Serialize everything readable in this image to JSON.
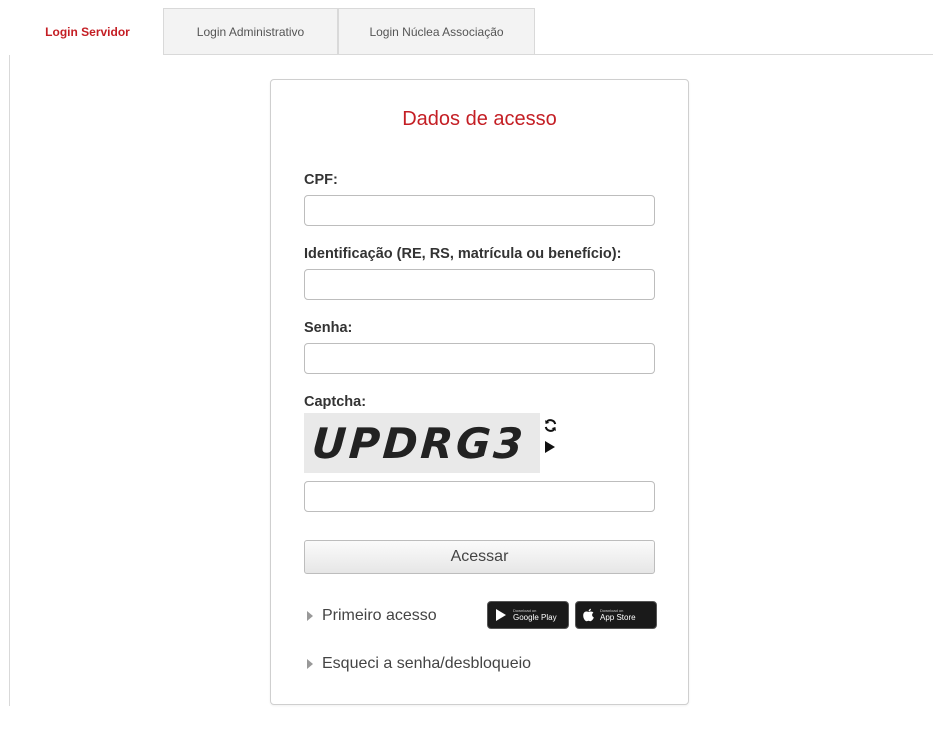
{
  "tabs": [
    "Login Servidor",
    "Login Administrativo",
    "Login Núclea Associação"
  ],
  "form": {
    "title": "Dados de acesso",
    "cpf_label": "CPF:",
    "cpf_value": "",
    "id_label": "Identificação (RE, RS, matrícula ou benefício):",
    "id_value": "",
    "senha_label": "Senha:",
    "senha_value": "",
    "captcha_label": "Captcha:",
    "captcha_text": "UPDRG3",
    "captcha_value": "",
    "submit_label": "Acessar"
  },
  "links": {
    "first_access": "Primeiro acesso",
    "forgot": "Esqueci a senha/desbloqueio"
  },
  "store_badges": {
    "google_small": "Download on",
    "google_big": "Google Play",
    "apple_small": "Download on",
    "apple_big": "App Store"
  },
  "icons": {
    "refresh": "refresh-icon",
    "play": "play-icon",
    "caret": "caret-right-icon",
    "google_play": "google-play-icon",
    "apple": "apple-icon"
  },
  "colors": {
    "accent": "#c41e24",
    "border": "#bdbdbd"
  }
}
